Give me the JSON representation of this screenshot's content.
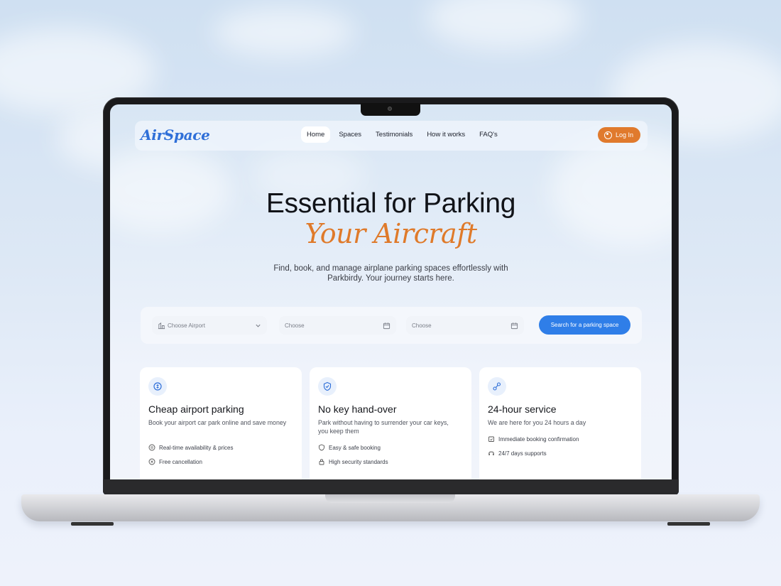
{
  "nav": {
    "logo": "AirSpace",
    "items": [
      "Home",
      "Spaces",
      "Testimonials",
      "How it works",
      "FAQ's"
    ],
    "active": "Home",
    "login_label": "Log In"
  },
  "hero": {
    "title": "Essential for Parking",
    "subtitle": "Your Aircraft",
    "description": "Find, book, and manage airplane parking spaces effortlessly with Parkbirdy. Your journey starts here."
  },
  "search": {
    "airport_placeholder": "Choose Airport",
    "date_from_placeholder": "Choose",
    "date_to_placeholder": "Choose",
    "button_label": "Search for a parking space"
  },
  "cards": [
    {
      "icon": "coin-icon",
      "title": "Cheap airport parking",
      "description": "Book your airport car park online and save money",
      "features": [
        {
          "icon": "price-tag-icon",
          "label": "Real-time availability & prices"
        },
        {
          "icon": "cancel-circle-icon",
          "label": "Free cancellation"
        }
      ]
    },
    {
      "icon": "shield-check-icon",
      "title": "No key hand-over",
      "description": "Park without having to surrender your car keys, you keep them",
      "features": [
        {
          "icon": "shield-icon",
          "label": "Easy & safe booking"
        },
        {
          "icon": "lock-icon",
          "label": "High security standards"
        }
      ]
    },
    {
      "icon": "route-icon",
      "title": "24-hour service",
      "description": "We are here for you 24 hours a day",
      "features": [
        {
          "icon": "calendar-check-icon",
          "label": "Immediate booking confirmation"
        },
        {
          "icon": "headset-icon",
          "label": "24/7 days supports"
        }
      ]
    }
  ],
  "colors": {
    "brand_blue": "#2f6fd8",
    "accent_orange": "#e07a2d",
    "button_blue": "#2f7ee8"
  }
}
